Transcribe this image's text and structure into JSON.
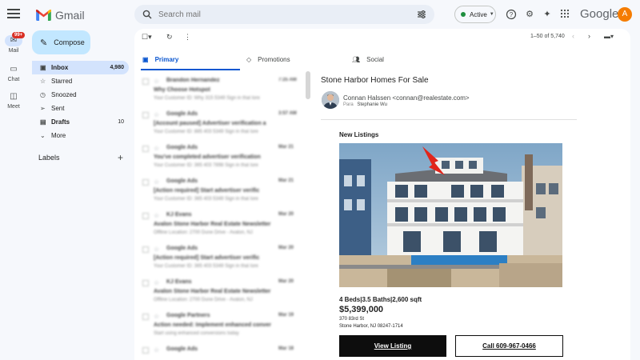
{
  "rail": {
    "badge": "99+",
    "items": [
      {
        "label": "Mail"
      },
      {
        "label": "Chat"
      },
      {
        "label": "Meet"
      }
    ]
  },
  "brand": {
    "app_name": "Gmail",
    "google": "Google"
  },
  "search": {
    "placeholder": "Search mail"
  },
  "status": {
    "label": "Active"
  },
  "avatar": {
    "initial": "A",
    "color": "#f57c00"
  },
  "compose": {
    "label": "Compose"
  },
  "nav": {
    "items": [
      {
        "label": "Inbox",
        "count": "4,980"
      },
      {
        "label": "Starred"
      },
      {
        "label": "Snoozed"
      },
      {
        "label": "Sent"
      },
      {
        "label": "Drafts",
        "count": "10"
      },
      {
        "label": "More"
      }
    ],
    "labels_heading": "Labels"
  },
  "toolbar": {
    "pager": "1–50 of 5,740"
  },
  "tabs": [
    {
      "label": "Primary"
    },
    {
      "label": "Promotions"
    },
    {
      "label": "Social"
    }
  ],
  "email_list": [
    {
      "sender": "Brandon Hernandez",
      "date": "7:25 AM",
      "subject": "Why Choose Hotspot",
      "snippet": "Your Customer ID: Why 315 5349 Sign in that lore"
    },
    {
      "sender": "Google Ads",
      "date": "3:57 AM",
      "subject": "[Account paused] Advertiser verification a",
      "snippet": "Your Customer ID: 885 403 5349 Sign in that lore"
    },
    {
      "sender": "Google Ads",
      "date": "Mar 21",
      "subject": "You've completed advertiser verification",
      "snippet": "Your Customer ID: 365 403 7898 Sign in that lore"
    },
    {
      "sender": "Google Ads",
      "date": "Mar 21",
      "subject": "[Action required] Start advertiser verific",
      "snippet": "Your Customer ID: 365 403 5349 Sign in that lore"
    },
    {
      "sender": "KJ Evans",
      "date": "Mar 20",
      "subject": "Avalon Stone Harbor Real Estate Newsletter",
      "snippet": "Offline Location: 2700 Dune Drive - Avalon, NJ"
    },
    {
      "sender": "Google Ads",
      "date": "Mar 20",
      "subject": "[Action required] Start advertiser verific",
      "snippet": "Your Customer ID: 365 403 5349 Sign in that lore"
    },
    {
      "sender": "KJ Evans",
      "date": "Mar 20",
      "subject": "Avalon Stone Harbor Real Estate Newsletter",
      "snippet": "Offline Location: 2700 Dune Drive - Avalon, NJ"
    },
    {
      "sender": "Google Partners",
      "date": "Mar 19",
      "subject": "Action needed: Implement enhanced conver",
      "snippet": "Start using enhanced conversions today"
    },
    {
      "sender": "Google Ads",
      "date": "Mar 18",
      "subject": "",
      "snippet": ""
    }
  ],
  "message": {
    "subject": "Stone Harbor Homes For Sale",
    "from_name": "Connan Halssen",
    "from_email": "<connan@realestate.com>",
    "to_label": "Para",
    "to_name": "Stephanie Wu",
    "section_title": "New Listings",
    "specs": "4 Beds|3.5 Baths|2,600 sqft",
    "price": "$5,399,000",
    "address_line1": "370 83rd St",
    "address_line2": "Stone Harbor, NJ 08247-1714",
    "view_button": "View Listing",
    "call_button": "Call 609-967-0466"
  },
  "colors": {
    "accent": "#0b57d0",
    "compose_bg": "#c2e7ff",
    "nav_active_bg": "#d3e3fd",
    "badge": "#d93025"
  }
}
